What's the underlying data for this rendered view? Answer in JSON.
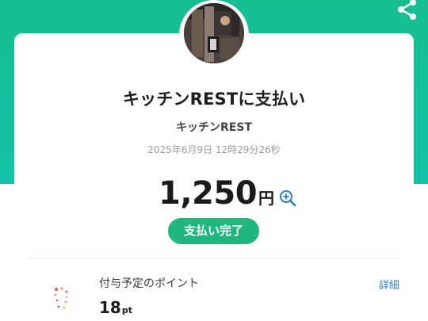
{
  "header": {
    "share_icon": "share-icon",
    "brand_color": "#16bd8f"
  },
  "payment": {
    "title": "キッチンRESTに支払い",
    "merchant": "キッチンREST",
    "timestamp": "2025年6月9日 12時29分26秒",
    "amount": "1,250",
    "currency": "円",
    "zoom_icon": "zoom-in-icon",
    "status": "支払い完了",
    "status_color": "#1fb77d"
  },
  "points": {
    "label": "付与予定のポイント",
    "value": "18",
    "unit": "pt",
    "detail_link": "詳細",
    "icon": "sparkle-points-icon"
  }
}
